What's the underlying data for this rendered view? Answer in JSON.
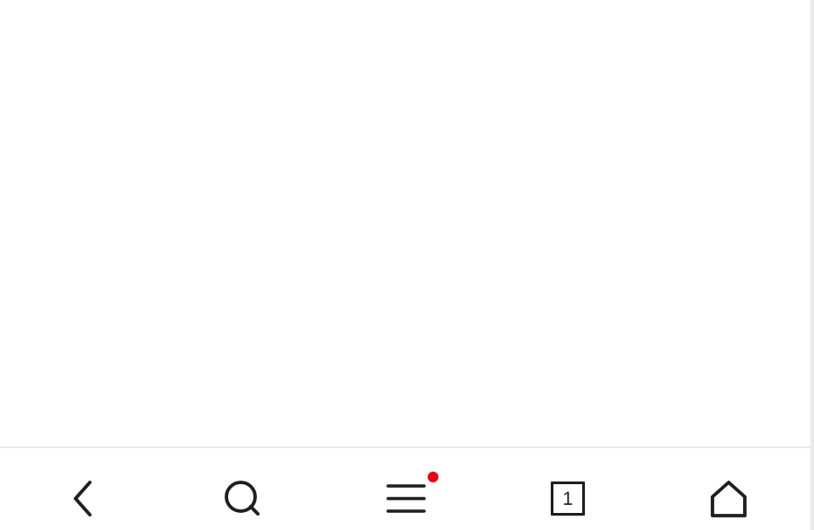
{
  "colors": {
    "page_background": "#ffffff",
    "icon": "#1f1f1f",
    "notification_dot": "#e60012",
    "divider": "#ececec",
    "right_edge": "#e9e9e9"
  },
  "toolbar": {
    "buttons": [
      {
        "id": "back",
        "icon": "back-icon"
      },
      {
        "id": "search",
        "icon": "search-icon"
      },
      {
        "id": "menu",
        "icon": "menu-icon",
        "has_notification_dot": true
      },
      {
        "id": "tabs",
        "icon": "tabs-icon"
      },
      {
        "id": "home",
        "icon": "home-icon"
      }
    ],
    "tab_count": "1"
  }
}
